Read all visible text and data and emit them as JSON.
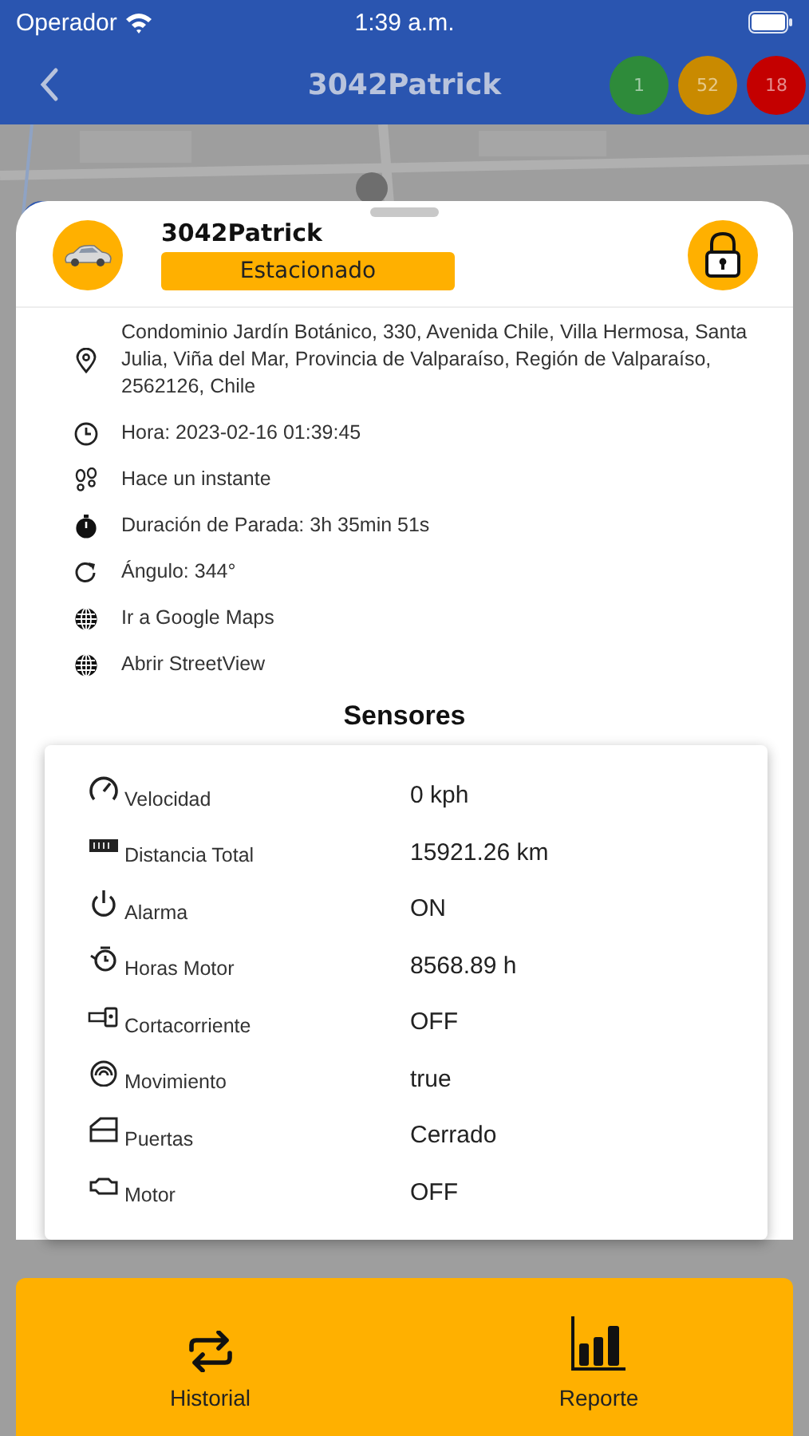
{
  "status_bar": {
    "carrier": "Operador",
    "time": "1:39 a.m."
  },
  "header": {
    "title": "3042Patrick",
    "counters": [
      {
        "value": "1",
        "color": "#2e8b3a"
      },
      {
        "value": "52",
        "color": "#c98a00"
      },
      {
        "value": "18",
        "color": "#c40000"
      }
    ]
  },
  "vehicle": {
    "name": "3042Patrick",
    "status": "Estacionado"
  },
  "info": [
    {
      "text": "Condominio Jardín Botánico, 330, Avenida Chile, Villa Hermosa, Santa Julia, Viña del Mar, Provincia de Valparaíso, Región de Valparaíso, 2562126, Chile"
    },
    {
      "text": "Hora: 2023-02-16 01:39:45"
    },
    {
      "text": "Hace un instante"
    },
    {
      "text": "Duración de Parada: 3h 35min 51s"
    },
    {
      "text": "Ángulo: 344°"
    },
    {
      "text": "Ir a Google Maps"
    },
    {
      "text": "Abrir StreetView"
    }
  ],
  "sensors_title": "Sensores",
  "sensors": [
    {
      "label": "Velocidad",
      "value": "0 kph"
    },
    {
      "label": "Distancia Total",
      "value": "15921.26 km"
    },
    {
      "label": "Alarma",
      "value": "ON"
    },
    {
      "label": "Horas Motor",
      "value": "8568.89 h"
    },
    {
      "label": "Cortacorriente",
      "value": "OFF"
    },
    {
      "label": "Movimiento",
      "value": "true"
    },
    {
      "label": "Puertas",
      "value": "Cerrado"
    },
    {
      "label": "Motor",
      "value": "OFF"
    }
  ],
  "bottom_bar": [
    {
      "label": "Historial"
    },
    {
      "label": "Reporte"
    }
  ]
}
